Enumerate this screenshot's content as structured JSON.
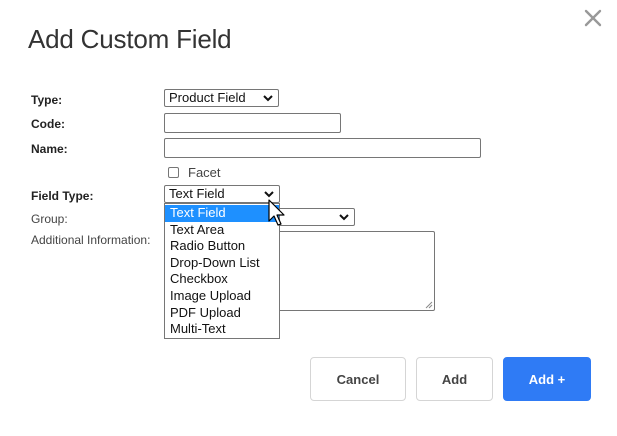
{
  "dialog": {
    "title": "Add Custom Field",
    "close_icon": "close-icon"
  },
  "form": {
    "type": {
      "label": "Type:",
      "value": "Product Field"
    },
    "code": {
      "label": "Code:",
      "value": ""
    },
    "name": {
      "label": "Name:",
      "value": ""
    },
    "facet": {
      "label": "Facet",
      "checked": false
    },
    "field_type": {
      "label": "Field Type:",
      "value": "Text Field",
      "options": [
        "Text Field",
        "Text Area",
        "Radio Button",
        "Drop-Down List",
        "Checkbox",
        "Image Upload",
        "PDF Upload",
        "Multi-Text"
      ],
      "highlighted": "Text Field"
    },
    "group": {
      "label": "Group:",
      "value": ""
    },
    "additional_information": {
      "label": "Additional Information:",
      "value": ""
    }
  },
  "buttons": {
    "cancel": "Cancel",
    "add": "Add",
    "add_plus": "Add +"
  },
  "colors": {
    "primary": "#2f7bf5",
    "highlight": "#1e90ff"
  }
}
